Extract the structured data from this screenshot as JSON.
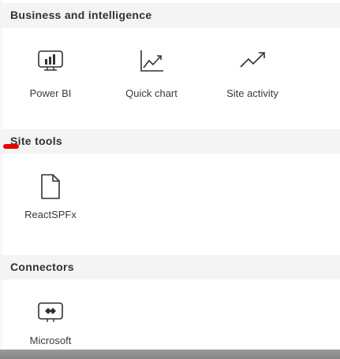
{
  "sections": {
    "business": {
      "title": "Business and intelligence",
      "tiles": [
        {
          "label": "Power BI",
          "icon": "power-bi-icon"
        },
        {
          "label": "Quick chart",
          "icon": "quick-chart-icon"
        },
        {
          "label": "Site activity",
          "icon": "site-activity-icon"
        }
      ]
    },
    "site_tools": {
      "title": "Site tools",
      "tiles": [
        {
          "label": "ReactSPFx",
          "icon": "document-icon"
        }
      ]
    },
    "connectors": {
      "title": "Connectors",
      "tiles": [
        {
          "label": "Microsoft\nPowerApps",
          "icon": "powerapps-icon"
        }
      ]
    }
  },
  "colors": {
    "header_bg": "#f4f4f4",
    "text": "#323130",
    "annotation": "#e60000"
  }
}
